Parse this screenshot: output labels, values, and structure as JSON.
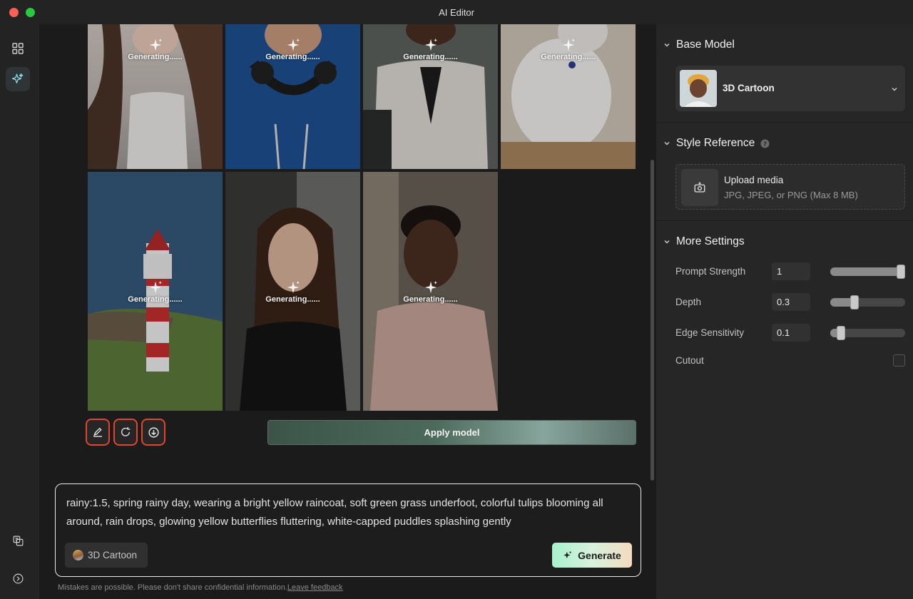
{
  "window": {
    "title": "AI Editor"
  },
  "gallery": {
    "status_text": "Generating......",
    "tiles": [
      {
        "subject": "woman-white-top"
      },
      {
        "subject": "man-blue-hoodie-headphones"
      },
      {
        "subject": "woman-white-cardigan"
      },
      {
        "subject": "white-cat"
      },
      {
        "subject": "lighthouse"
      },
      {
        "subject": "woman-black-top"
      },
      {
        "subject": "man-pink-shirt"
      }
    ]
  },
  "actions": {
    "edit_icon": "pencil-icon",
    "regenerate_icon": "refresh-icon",
    "download_icon": "download-icon",
    "apply_label": "Apply model"
  },
  "prompt": {
    "text": "rainy:1.5, spring rainy day, wearing a bright yellow raincoat, soft green grass underfoot, colorful tulips blooming all around, rain drops, glowing yellow butterflies fluttering, white-capped puddles splashing gently",
    "model_chip": "3D Cartoon",
    "generate_label": "Generate"
  },
  "footer": {
    "disclaimer": "Mistakes are possible. Please don't share confidential information.",
    "feedback_link": "Leave feedback"
  },
  "panel": {
    "base_model": {
      "heading": "Base Model",
      "selected": "3D Cartoon"
    },
    "style_reference": {
      "heading": "Style Reference",
      "upload_title": "Upload media",
      "upload_hint": "JPG, JPEG, or PNG (Max 8 MB)"
    },
    "more_settings": {
      "heading": "More Settings",
      "prompt_strength": {
        "label": "Prompt Strength",
        "value": "1",
        "fraction": 1.0
      },
      "depth": {
        "label": "Depth",
        "value": "0.3",
        "fraction": 0.3
      },
      "edge_sensitivity": {
        "label": "Edge Sensitivity",
        "value": "0.1",
        "fraction": 0.1
      },
      "cutout": {
        "label": "Cutout",
        "checked": false
      }
    }
  },
  "colors": {
    "accent_red": "#e0462c",
    "generate_gradient_start": "#a7f2cc",
    "generate_gradient_end": "#f3dcc0"
  }
}
